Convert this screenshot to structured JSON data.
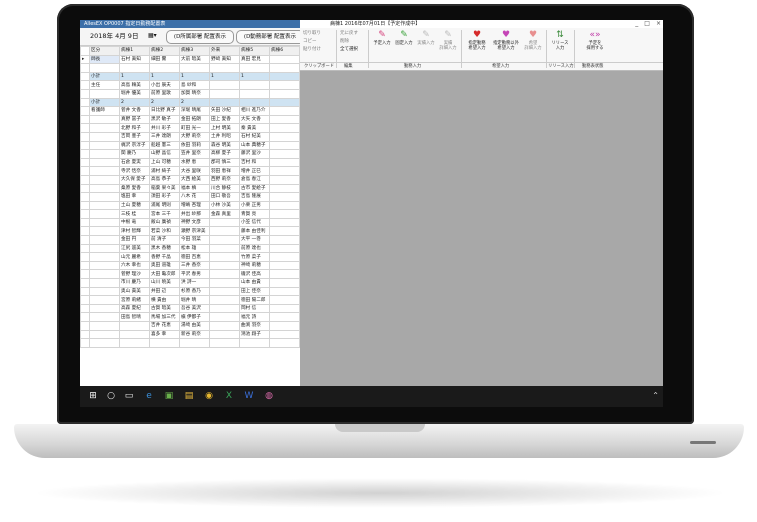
{
  "window": {
    "app_title": "AllesEX OP0007 指定日勤務配置表",
    "center_title": "病棟1 2016年07月01日【予定作成中】",
    "buttons": [
      "_",
      "□",
      "×"
    ]
  },
  "toolbar": {
    "date_text": "2018年 4月 9日",
    "btn_own_dept": "(D所属部署 配置表示",
    "btn_mobile_dept": "(D動務部署 配置表示"
  },
  "table": {
    "header": [
      "区分",
      "病棟1",
      "病棟2",
      "病棟3",
      "外来",
      "病棟5",
      "病棟6"
    ],
    "rows": [
      {
        "cls": "sel",
        "cells": [
          "師長",
          "石村 眞知",
          "細田 實",
          "大前 暗美",
          "野﨑 眞知",
          "真田 宏見",
          ""
        ]
      },
      {
        "cls": "",
        "cells": [
          "",
          "",
          "",
          "",
          "",
          "",
          ""
        ]
      },
      {
        "cls": "blue",
        "cells": [
          "小計",
          "1",
          "1",
          "1",
          "1",
          "1",
          ""
        ]
      },
      {
        "cls": "",
        "cells": [
          "主任",
          "高島 賴美",
          "小出 辰夫",
          "島 紗和",
          "",
          "",
          ""
        ]
      },
      {
        "cls": "",
        "cells": [
          "",
          "堀井 優美",
          "前原 里歌",
          "加賀 晴奈",
          "",
          "",
          ""
        ]
      },
      {
        "cls": "blue",
        "cells": [
          "小計",
          "2",
          "2",
          "2",
          "",
          "",
          ""
        ]
      },
      {
        "cls": "",
        "cells": [
          "看護師",
          "菅井 文香",
          "日比野 真子",
          "深堀 晴尾",
          "矢田 沙紀",
          "相川 進乃介",
          ""
        ]
      },
      {
        "cls": "",
        "cells": [
          "",
          "真野 冨子",
          "黒沢 敏子",
          "金田 拓朗",
          "田上 愛香",
          "大矢 文香",
          ""
        ]
      },
      {
        "cls": "",
        "cells": [
          "",
          "北野 和子",
          "井川 彩子",
          "町田 光一",
          "上村 明美",
          "秦 貴美",
          ""
        ]
      },
      {
        "cls": "",
        "cells": [
          "",
          "吉岡 豊子",
          "三井 達朗",
          "大野 莉奈",
          "土井 利昭",
          "石村 紀美",
          ""
        ]
      },
      {
        "cls": "",
        "cells": [
          "",
          "梶沢 宗淳子",
          "船越 憲三",
          "依田 羽莉",
          "森谷 明美",
          "山本 典穂子",
          ""
        ]
      },
      {
        "cls": "",
        "cells": [
          "",
          "関 慶乃",
          "山野 晶信",
          "笠井 里奈",
          "高柳 夏子",
          "藤沢 里沙",
          ""
        ]
      },
      {
        "cls": "",
        "cells": [
          "",
          "石倉 夏実",
          "上山 可穂",
          "水野 恵",
          "郡司 慎三",
          "吉村 和",
          ""
        ]
      },
      {
        "cls": "",
        "cells": [
          "",
          "寺沢 恬奈",
          "浦村 綺子",
          "大谷 里咲",
          "羽田 恵祥",
          "増井 正巳",
          ""
        ]
      },
      {
        "cls": "",
        "cells": [
          "",
          "大久保 愛子",
          "高島 恭子",
          "大西 絵美",
          "西野 莉奈",
          "倉島 春江",
          ""
        ]
      },
      {
        "cls": "",
        "cells": [
          "",
          "桑原 愛香",
          "稲葉 果々美",
          "福本 槙",
          "川合 静枝",
          "古市 愛絵子",
          ""
        ]
      },
      {
        "cls": "",
        "cells": [
          "",
          "塩田 幸",
          "須田 彩子",
          "八木 花",
          "田口 敬吾",
          "吉島 隆展",
          ""
        ]
      },
      {
        "cls": "",
        "cells": [
          "",
          "土山 夏穂",
          "浦尾 明則",
          "増嶋 杏理",
          "小林 沙美",
          "小栗 正男",
          ""
        ]
      },
      {
        "cls": "",
        "cells": [
          "",
          "三枝 桂",
          "宮本 三千",
          "井出 紗那",
          "金森 真里",
          "青賀 亮",
          ""
        ]
      },
      {
        "cls": "",
        "cells": [
          "",
          "中根 竜",
          "飯山 廣禎",
          "神野 文彦",
          "",
          "小笠 信代",
          ""
        ]
      },
      {
        "cls": "",
        "cells": [
          "",
          "津村 智輝",
          "若菜 沙和",
          "瀬野 宗津美",
          "",
          "藤本 由佳利",
          ""
        ]
      },
      {
        "cls": "",
        "cells": [
          "",
          "金田 円",
          "前 清子",
          "今田 羽菜",
          "",
          "大平 一巻",
          ""
        ]
      },
      {
        "cls": "",
        "cells": [
          "",
          "江尻 遥美",
          "黒木 香穂",
          "松本 雄",
          "",
          "前原 達也",
          ""
        ]
      },
      {
        "cls": "",
        "cells": [
          "",
          "山元 麗希",
          "香野 千晶",
          "徳田 百恵",
          "",
          "竹原 菜子",
          ""
        ]
      },
      {
        "cls": "",
        "cells": [
          "",
          "六木 幸也",
          "奥田 道雄",
          "三井 香奈",
          "",
          "神崎 莉穂",
          ""
        ]
      },
      {
        "cls": "",
        "cells": [
          "",
          "菅野 理沙",
          "大田 亀次郎",
          "平沢 春男",
          "",
          "磯沢 佳高",
          ""
        ]
      },
      {
        "cls": "",
        "cells": [
          "",
          "市川 慶乃",
          "山川 暁美",
          "洪 詩一",
          "",
          "山本 由貴",
          ""
        ]
      },
      {
        "cls": "",
        "cells": [
          "",
          "奥山 貴美",
          "井田 辺",
          "杉原 香乃",
          "",
          "田上 佳奈",
          ""
        ]
      },
      {
        "cls": "",
        "cells": [
          "",
          "宮原 莉緒",
          "横 貴由",
          "堀井 晴",
          "",
          "徳田 陽二郎",
          ""
        ]
      },
      {
        "cls": "",
        "cells": [
          "",
          "高森 夏紀",
          "古賀 暗美",
          "吾谷 美沢",
          "",
          "岡村 信",
          ""
        ]
      },
      {
        "cls": "",
        "cells": [
          "",
          "田島 智晴",
          "馬場 加三代",
          "槇 伊都子",
          "",
          "福元 詩",
          ""
        ]
      },
      {
        "cls": "",
        "cells": [
          "",
          "",
          "吉井 花恵",
          "湯崎 由美",
          "",
          "曲渕 羽奈",
          ""
        ]
      },
      {
        "cls": "",
        "cells": [
          "",
          "",
          "喜多 幸",
          "新谷 莉奈",
          "",
          "鴻池 翔子",
          ""
        ]
      },
      {
        "cls": "",
        "cells": [
          "",
          "",
          "",
          "",
          "",
          "",
          ""
        ]
      }
    ]
  },
  "ribbon": {
    "clipboard": [
      "切り取り",
      "コピー",
      "貼り付け"
    ],
    "edit": [
      "元に戻す",
      "削除",
      "全て選択"
    ],
    "work_input": [
      "予定入力",
      "固定入力",
      "実績入力",
      "実績\n詳細入力"
    ],
    "hope_input": [
      "指定勤務\n希望入力",
      "指定勤務以外\n希望入力",
      "希望\n詳細入力"
    ],
    "release": [
      "リリース\n入力"
    ],
    "display": [
      "予定を\n採用する"
    ],
    "group_labels": [
      "クリップボード",
      "編集",
      "勤務入力",
      "希望入力",
      "リリース入力",
      "勤務表状態"
    ]
  },
  "taskbar": {
    "icons": [
      "windows-icon",
      "search-icon",
      "task-view-icon",
      "edge-icon",
      "store-icon",
      "explorer-icon",
      "chrome-icon",
      "excel-icon",
      "word-icon",
      "app-icon"
    ]
  },
  "colors": {
    "titlebar": "#3c6fa8",
    "subtotal_row": "#cfe3f2",
    "workspace": "#a8a8a8"
  }
}
